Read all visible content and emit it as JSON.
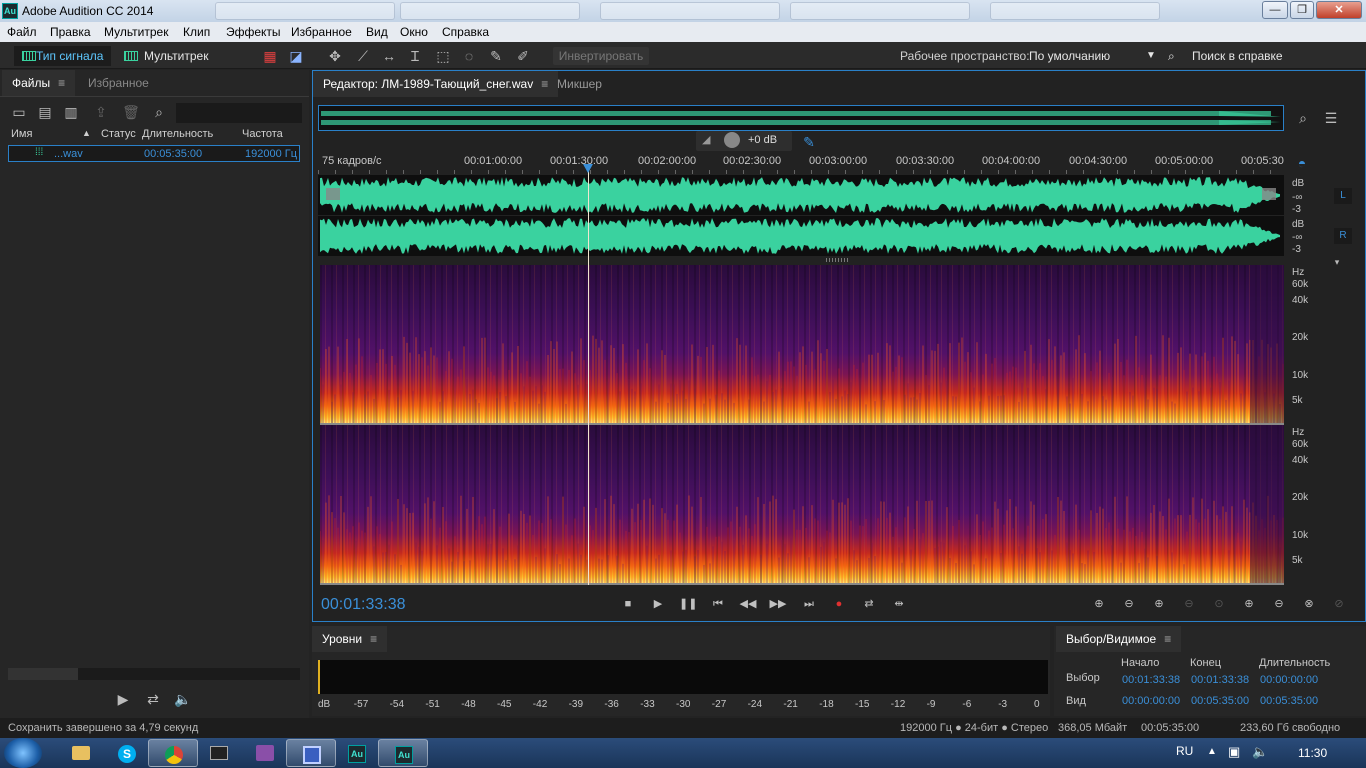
{
  "app": {
    "title": "Adobe Audition CC 2014",
    "icon_text": "Au"
  },
  "window_controls": {
    "minimize": "—",
    "maximize": "❐",
    "close": "✕"
  },
  "menu": [
    "Файл",
    "Правка",
    "Мультитрек",
    "Клип",
    "Эффекты",
    "Избранное",
    "Вид",
    "Окно",
    "Справка"
  ],
  "toolbar": {
    "waveform_label": "Тип сигнала",
    "multitrack_label": "Мультитрек",
    "invert_label": "Инвертировать",
    "workspace_label": "Рабочее пространство:",
    "workspace_value": "По умолчанию",
    "help_search_label": "Поиск в справке"
  },
  "files_panel": {
    "tabs": [
      "Файлы",
      "Избранное"
    ],
    "columns": [
      "Имя",
      "Статус",
      "Длительность",
      "Частота"
    ],
    "rows": [
      {
        "name": "...wav",
        "status": "",
        "duration": "00:05:35:00",
        "rate": "192000 Гц"
      }
    ]
  },
  "editor": {
    "tab_label": "Редактор: ЛМ-1989-Тающий_снег.wav",
    "mixer_label": "Микшер",
    "gain_label": "+0 dB",
    "ruler_label": "75 кадров/с",
    "ruler_ticks": [
      "00:01:00:00",
      "00:01:30:00",
      "00:02:00:00",
      "00:02:30:00",
      "00:03:00:00",
      "00:03:30:00",
      "00:04:00:00",
      "00:04:30:00",
      "00:05:00:00",
      "00:05:30"
    ],
    "db_scale": [
      "dB",
      "-∞",
      "-3"
    ],
    "channels": [
      "L",
      "R"
    ],
    "hz_scale": [
      "Hz",
      "60k",
      "40k",
      "20k",
      "10k",
      "5k"
    ],
    "timecode": "00:01:33:38",
    "playhead_fraction": 0.278
  },
  "levels_panel": {
    "title": "Уровни",
    "scale": [
      "dB",
      "-57",
      "-54",
      "-51",
      "-48",
      "-45",
      "-42",
      "-39",
      "-36",
      "-33",
      "-30",
      "-27",
      "-24",
      "-21",
      "-18",
      "-15",
      "-12",
      "-9",
      "-6",
      "-3",
      "0"
    ]
  },
  "selection_panel": {
    "title": "Выбор/Видимое",
    "headers": [
      "Начало",
      "Конец",
      "Длительность"
    ],
    "selection": {
      "label": "Выбор",
      "start": "00:01:33:38",
      "end": "00:01:33:38",
      "duration": "00:00:00:00"
    },
    "view": {
      "label": "Вид",
      "start": "00:00:00:00",
      "end": "00:05:35:00",
      "duration": "00:05:35:00"
    }
  },
  "statusbar": {
    "message": "Сохранить завершено за 4,79 секунд",
    "format": "192000 Гц ● 24-бит ● Стерео",
    "size": "368,05 Мбайт",
    "duration": "00:05:35:00",
    "free": "233,60 Гб свободно"
  },
  "taskbar": {
    "lang": "RU",
    "time": "11:30",
    "apps": [
      "explorer-icon",
      "skype-icon",
      "chrome-icon",
      "terminal-icon",
      "winrar-icon",
      "save-icon",
      "audition-icon",
      "audition-icon"
    ]
  },
  "colors": {
    "waveform": "#3ad29f",
    "accent": "#2a80c8",
    "timecode": "#3a8fd8"
  }
}
